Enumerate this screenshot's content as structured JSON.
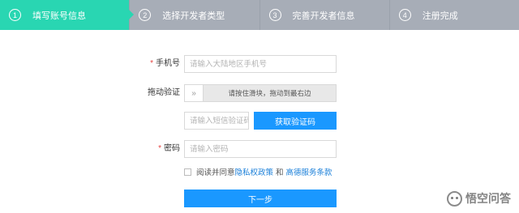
{
  "steps": [
    {
      "num": "1",
      "label": "填写账号信息"
    },
    {
      "num": "2",
      "label": "选择开发者类型"
    },
    {
      "num": "3",
      "label": "完善开发者信息"
    },
    {
      "num": "4",
      "label": "注册完成"
    }
  ],
  "form": {
    "phone": {
      "required_mark": "*",
      "label": "手机号",
      "placeholder": "请输入大陆地区手机号"
    },
    "slider": {
      "label": "拖动验证",
      "handle_icon": "double-chevron-right-icon",
      "handle_glyph": "»",
      "hint": "请按住滑块，拖动到最右边"
    },
    "sms": {
      "placeholder": "请输入短信验证码",
      "button_label": "获取验证码"
    },
    "password": {
      "required_mark": "*",
      "label": "密码",
      "placeholder": "请输入密码"
    },
    "agreement": {
      "prefix": "阅读并同意",
      "privacy_link": "隐私权政策",
      "and": "和",
      "service_link": "高德服务条款",
      "checked": false
    },
    "next_button": "下一步"
  },
  "watermark": {
    "text": "悟空问答"
  },
  "colors": {
    "active_step": "#29d6b2",
    "inactive_step": "#a7adb7",
    "primary": "#1a98ff",
    "link": "#1a7fd9",
    "required": "#e64340"
  }
}
